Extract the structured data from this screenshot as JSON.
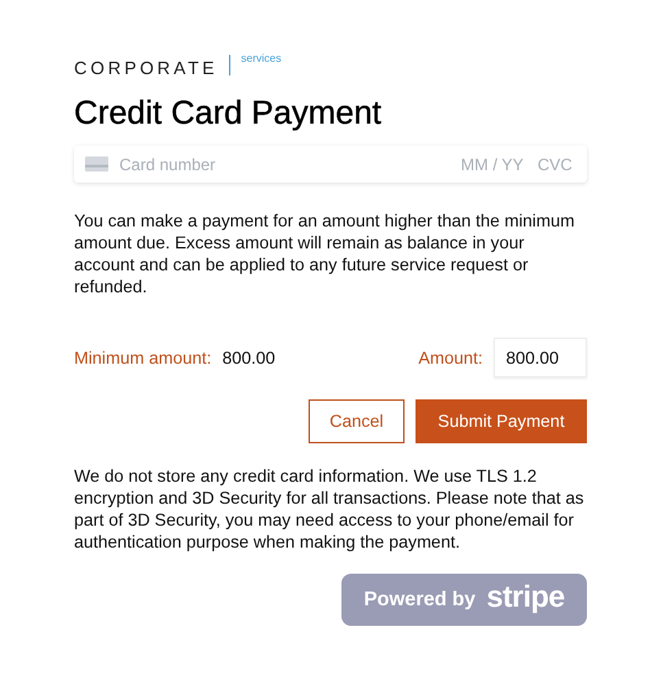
{
  "logo": {
    "name": "CORPORATE",
    "tagline": "services"
  },
  "title": "Credit Card Payment",
  "card_field": {
    "placeholder": "Card number",
    "expiry_placeholder": "MM / YY",
    "cvc_placeholder": "CVC"
  },
  "notice": "You can make a payment for an amount higher than the minimum amount due. Excess amount will remain as balance in your account and can be applied to any future service request or refunded.",
  "minimum_amount": {
    "label": "Minimum amount:",
    "value": "800.00"
  },
  "amount": {
    "label": "Amount:",
    "value": "800.00"
  },
  "buttons": [
    {
      "label": "Cancel",
      "kind": "secondary"
    },
    {
      "label": "Submit Payment",
      "kind": "primary"
    }
  ],
  "security_note": "We do not store any credit card information. We use TLS 1.2 encryption and 3D Security for all transactions. Please note that as part of 3D Security, you may need access to your phone/email for authentication purpose when making the payment.",
  "badge": {
    "prefix": "Powered by",
    "brand": "stripe"
  }
}
